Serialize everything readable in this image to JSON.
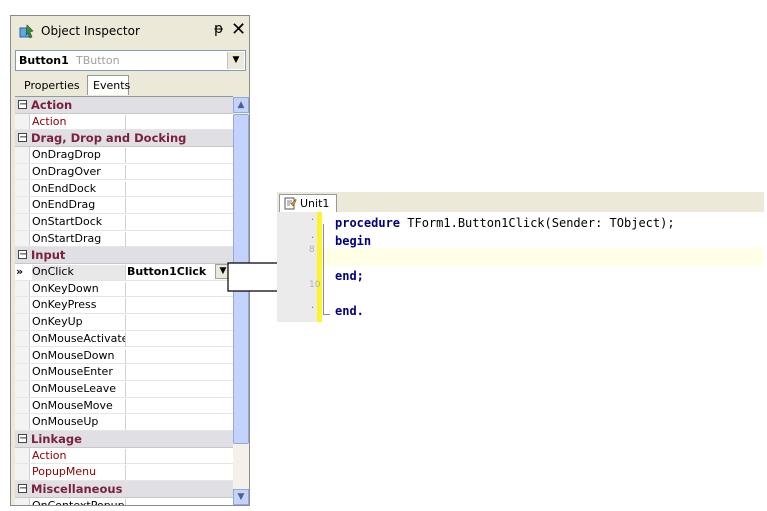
{
  "inspector": {
    "title": "Object Inspector",
    "pin_glyph": "ᵽ",
    "close_glyph": "✕",
    "selected_component": "Button1",
    "selected_type": "TButton",
    "tabs": [
      "Properties",
      "Events"
    ],
    "rows": [
      {
        "kind": "cat",
        "name": "Action"
      },
      {
        "kind": "prop",
        "name": "Action",
        "red": true
      },
      {
        "kind": "cat",
        "name": "Drag, Drop and Docking"
      },
      {
        "kind": "prop",
        "name": "OnDragDrop"
      },
      {
        "kind": "prop",
        "name": "OnDragOver"
      },
      {
        "kind": "prop",
        "name": "OnEndDock"
      },
      {
        "kind": "prop",
        "name": "OnEndDrag"
      },
      {
        "kind": "prop",
        "name": "OnStartDock"
      },
      {
        "kind": "prop",
        "name": "OnStartDrag"
      },
      {
        "kind": "cat",
        "name": "Input"
      },
      {
        "kind": "prop",
        "name": "OnClick",
        "value": "Button1Click",
        "selected": true
      },
      {
        "kind": "prop",
        "name": "OnKeyDown"
      },
      {
        "kind": "prop",
        "name": "OnKeyPress"
      },
      {
        "kind": "prop",
        "name": "OnKeyUp"
      },
      {
        "kind": "prop",
        "name": "OnMouseActivate"
      },
      {
        "kind": "prop",
        "name": "OnMouseDown"
      },
      {
        "kind": "prop",
        "name": "OnMouseEnter"
      },
      {
        "kind": "prop",
        "name": "OnMouseLeave"
      },
      {
        "kind": "prop",
        "name": "OnMouseMove"
      },
      {
        "kind": "prop",
        "name": "OnMouseUp"
      },
      {
        "kind": "cat",
        "name": "Linkage"
      },
      {
        "kind": "prop",
        "name": "Action",
        "red": true
      },
      {
        "kind": "prop",
        "name": "PopupMenu",
        "red": true
      },
      {
        "kind": "cat",
        "name": "Miscellaneous"
      },
      {
        "kind": "prop",
        "name": "OnContextPopup"
      }
    ]
  },
  "editor": {
    "tab_label": "Unit1",
    "gutter_numbers": [
      "8",
      "10"
    ],
    "lines": [
      {
        "keyword": "procedure",
        "rest": " TForm1.Button1Click(Sender: TObject);"
      },
      {
        "keyword": "begin",
        "rest": ""
      },
      {
        "keyword": "",
        "rest": ""
      },
      {
        "keyword": "end;",
        "rest": ""
      },
      {
        "keyword": "",
        "rest": ""
      },
      {
        "keyword": "end.",
        "rest": ""
      }
    ]
  },
  "colors": {
    "category_text": "#7a1f3d",
    "link_property_text": "#8b0000",
    "keyword": "#000080",
    "modified_bar": "#fff22e"
  }
}
